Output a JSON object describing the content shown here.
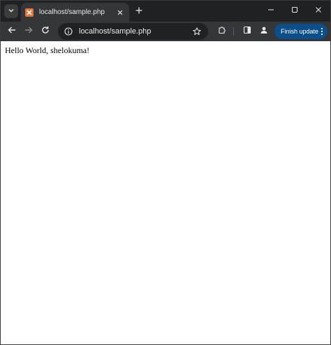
{
  "tab": {
    "title": "localhost/sample.php",
    "favicon": "xampp-favicon-icon"
  },
  "omnibox": {
    "url": "localhost/sample.php"
  },
  "toolbar": {
    "finish_update_label": "Finish update"
  },
  "page": {
    "text": "Hello World, shelokuma!"
  },
  "colors": {
    "tabstrip_bg": "#202124",
    "toolbar_bg": "#35363a",
    "omnibox_bg": "#202124",
    "update_button_bg": "#0b4f8a",
    "favicon_bg": "#e2763b"
  }
}
